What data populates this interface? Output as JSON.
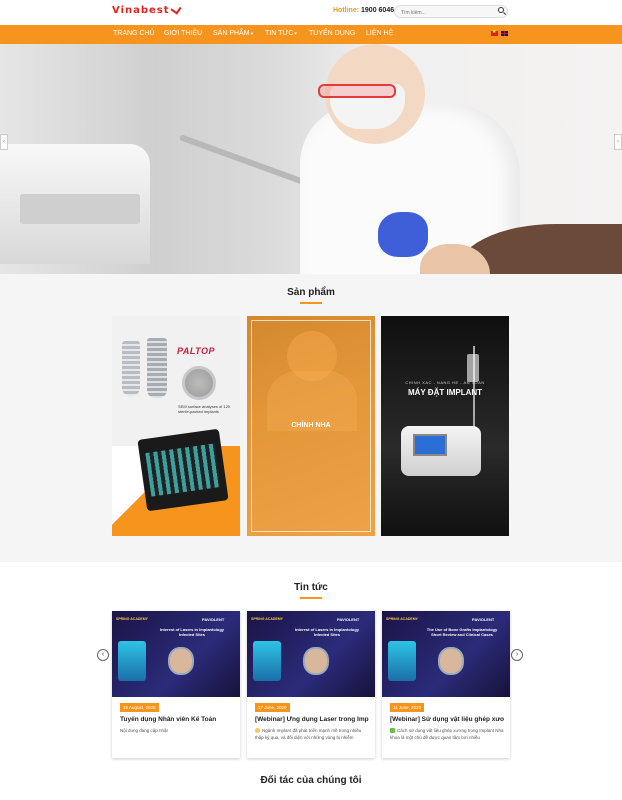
{
  "header": {
    "logo_text": "Vinabest",
    "hotline_label": "Hotline:",
    "hotline_number": "1900 6046",
    "search_placeholder": "Tìm kiếm..."
  },
  "nav": {
    "items": [
      {
        "label": "Trang chủ"
      },
      {
        "label": "Giới thiệu"
      },
      {
        "label": "Sản phẩm"
      },
      {
        "label": "Tin tức"
      },
      {
        "label": "Tuyển dụng"
      },
      {
        "label": "Liên hệ"
      }
    ],
    "languages": [
      "vi",
      "en"
    ]
  },
  "colors": {
    "accent": "#f7941d",
    "logo_red": "#e2231a"
  },
  "products": {
    "title": "Sản phẩm",
    "items": [
      {
        "brand": "PALTOP",
        "caption": "SEM surface analyses of 120 sterile-packed implants"
      },
      {
        "label": "CHỈNH NHA"
      },
      {
        "subtitle": "CHINH XAC - NANG HE - AN TOAN",
        "title": "MÁY ĐẶT IMPLANT"
      }
    ]
  },
  "news": {
    "title": "Tin tức",
    "items": [
      {
        "thumb_title": "Interest of Lasers in Implantology Infected Sites",
        "thumb_brand": "PAVIOLENT",
        "thumb_corner": "SPRING ACADEMY",
        "date": "15 August, 2020",
        "title": "Tuyển dụng Nhân viên Kế Toán",
        "desc": "Nội dung đang cập nhật"
      },
      {
        "thumb_title": "Interest of Lasers in Implantology Infected Sites",
        "thumb_brand": "PAVIOLENT",
        "thumb_corner": "SPRING ACADEMY",
        "date": "17 June, 2020",
        "title": "[Webinar] Ứng dụng Laser trong Impl...",
        "desc": "Ngành Implant đã phát triển mạnh mẽ trong nhiều thập kỷ qua, và đối diện với những vùng bị nhiễm"
      },
      {
        "thumb_title": "The Use of Bone Grafts Implantology Short Review and Clinical Cases",
        "thumb_brand": "PAVIOLENT",
        "thumb_corner": "SPRING ACADEMY",
        "date": "11 June, 2020",
        "title": "[Webinar] Sử dụng vật liệu ghép xươ...",
        "desc": "Cách sử dụng vật liệu ghép xương trong Implant Nha khoa là một chủ đề được quan tâm bởi nhiều"
      }
    ]
  },
  "partners": {
    "title": "Đối tác của chúng tôi"
  }
}
